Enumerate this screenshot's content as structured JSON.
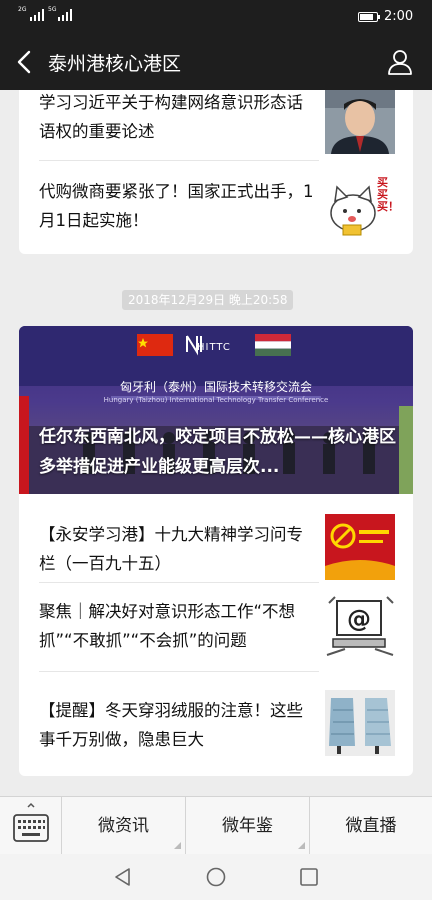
{
  "status_bar": {
    "sim1_label": "2G",
    "sim2_label": "5G",
    "time": "2:00",
    "battery_level": 0.8
  },
  "nav": {
    "title": "泰州港核心港区"
  },
  "feed": {
    "card_a": {
      "items": [
        {
          "title": "学习习近平关于构建网络意识形态话语权的重要论述",
          "thumb_icon": "portrait-photo"
        },
        {
          "title": "代购微商要紧张了！国家正式出手，1月1日起实施！",
          "thumb_icon": "cartoon-cat-sticker",
          "thumb_text": "买买买！"
        }
      ]
    },
    "timestamp": "2018年12月29日 晚上20:58",
    "card_b": {
      "cover": {
        "title": "任尔东西南北风，咬定项目不放松——核心港区多举措促进产业能级更高层次...",
        "banner_logo": "HITTC",
        "banner_subtitle": "匈牙利（泰州）国际技术转移交流会",
        "banner_subtitle_en": "Hungary (Taizhou) International Technology Transfer Conference"
      },
      "items": [
        {
          "title": "【永安学习港】十九大精神学习问专栏（一百九十五）",
          "thumb_icon": "party-emblem-banner"
        },
        {
          "title": "聚焦｜解决好对意识形态工作“不想抓”“不敢抓”“不会抓”的问题",
          "thumb_icon": "computer-at-sign-illustration"
        },
        {
          "title": "【提醒】冬天穿羽绒服的注意！这些事千万别做，隐患巨大",
          "thumb_icon": "down-jacket-photo"
        }
      ]
    }
  },
  "menu": {
    "keyboard_icon": "keyboard-icon",
    "tabs": [
      {
        "label": "微资讯"
      },
      {
        "label": "微年鉴"
      },
      {
        "label": "微直播"
      }
    ]
  },
  "colors": {
    "dark_bar": "#1e1e1e",
    "background": "#ededed",
    "accent_red": "#c8161e"
  }
}
